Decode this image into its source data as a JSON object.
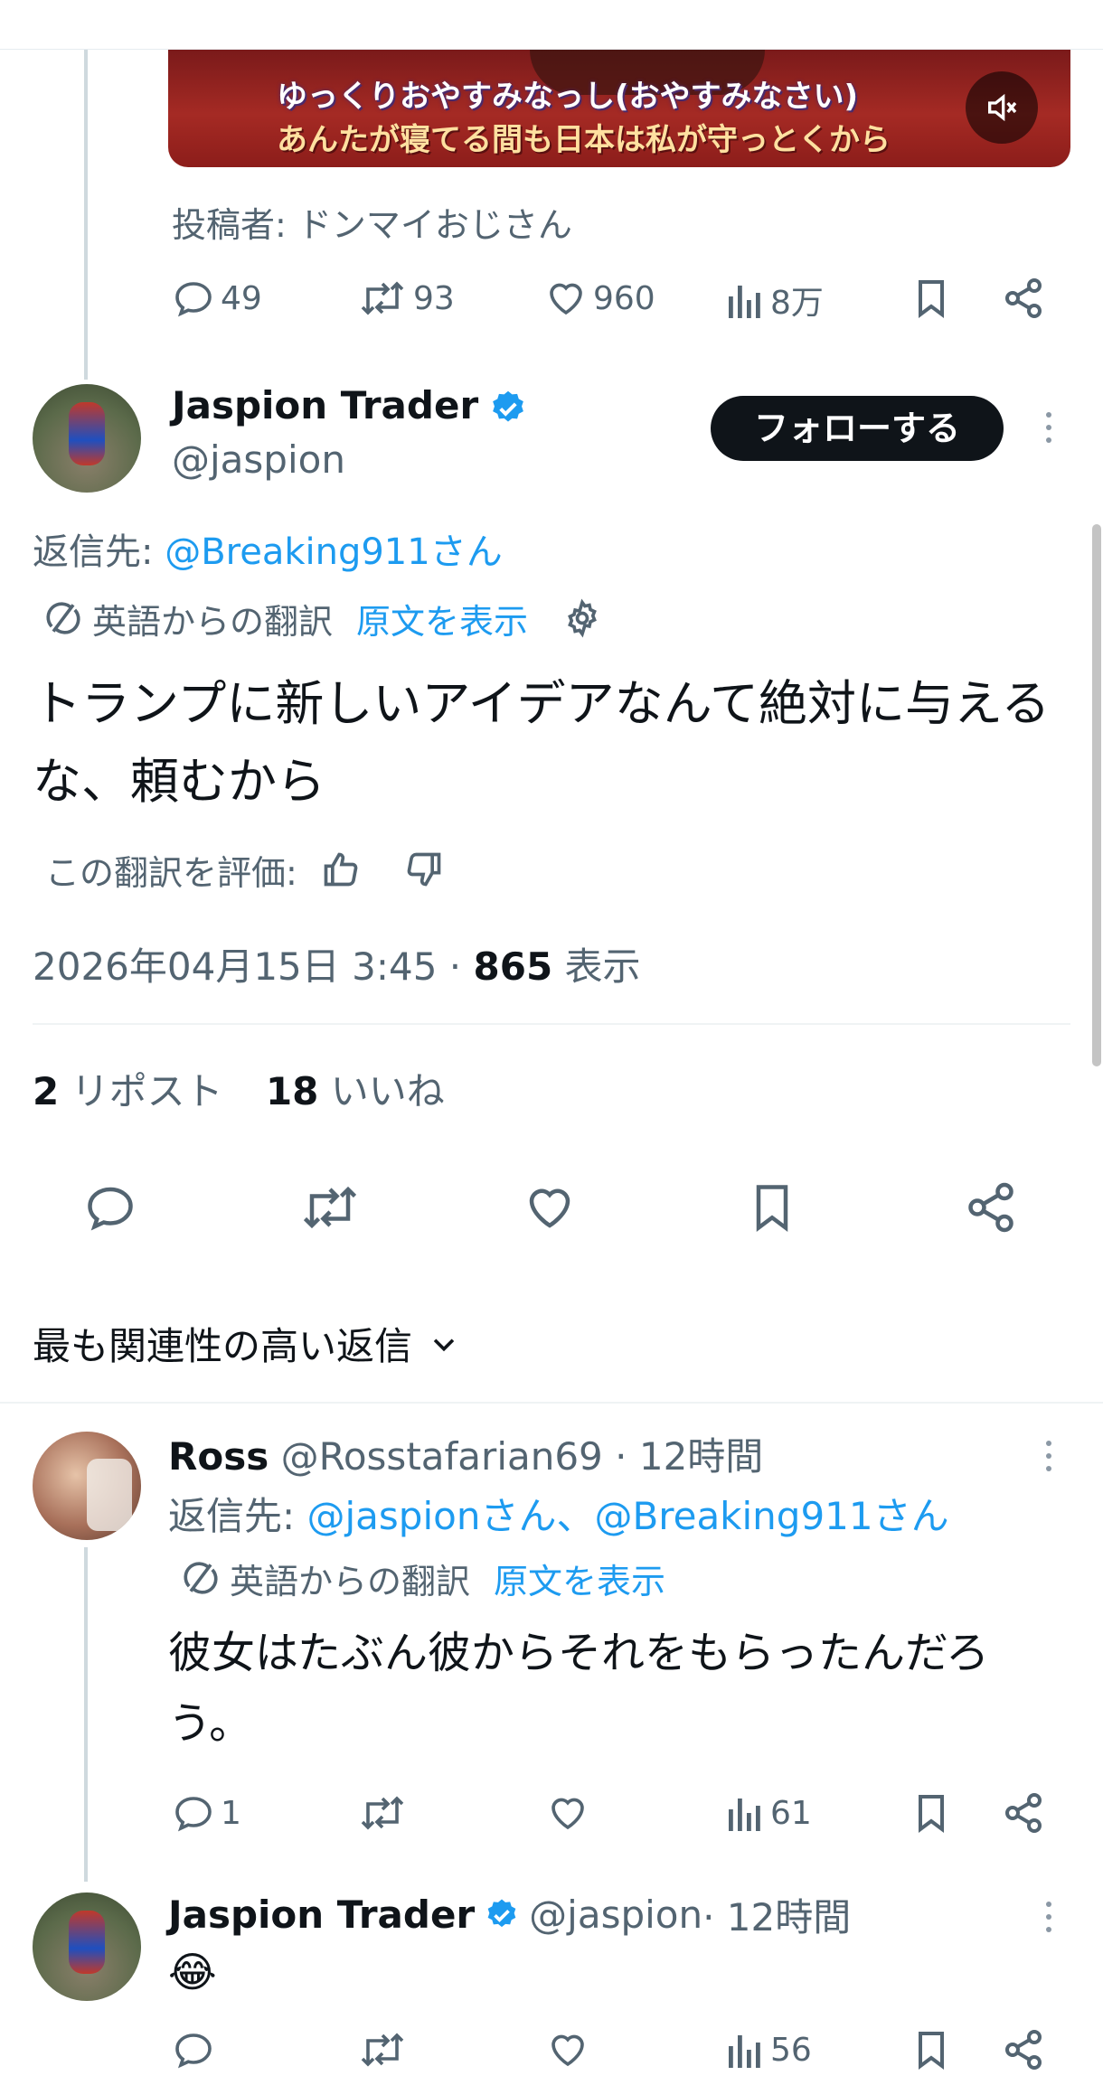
{
  "video": {
    "caption_line1": "ゆっくりおやすみなっし(おやすみなさい)",
    "caption_line2": "あんたが寝てる間も日本は私が守っとくから"
  },
  "quoted_post": {
    "posted_by": "投稿者: ドンマイおじさん",
    "stats": {
      "replies": "49",
      "reposts": "93",
      "likes": "960",
      "views": "8万"
    }
  },
  "main_post": {
    "author_name": "Jaspion Trader",
    "handle": "@jaspion",
    "follow_label": "フォローする",
    "reply_to_prefix": "返信先: ",
    "reply_to_handle": "@Breaking911さん",
    "translated_from": "英語からの翻訳",
    "show_original": "原文を表示",
    "text": "トランプに新しいアイデアなんて絶対に与えるな、頼むから",
    "rate_translation": "この翻訳を評価:",
    "timestamp": "2026年04月15日 3:45 · ",
    "views_count": "865",
    "views_label": " 表示",
    "reposts_count": "2",
    "reposts_label": " リポスト",
    "likes_count": "18",
    "likes_label": " いいね"
  },
  "replies_sort": {
    "label": "最も関連性の高い返信"
  },
  "replies": [
    {
      "name": "Ross",
      "handle": "@Rosstafarian69",
      "time": " · 12時間",
      "reply_to_prefix": "返信先: ",
      "reply_to_handles": "@jaspionさん、@Breaking911さん",
      "translated_from": "英語からの翻訳",
      "show_original": "原文を表示",
      "text": "彼女はたぶん彼からそれをもらったんだろう。",
      "stats": {
        "replies": "1",
        "views": "61"
      }
    },
    {
      "name": "Jaspion Trader",
      "handle": "@jaspion",
      "time": " · 12時間",
      "text": "😂",
      "stats": {
        "views": "56"
      }
    }
  ],
  "colors": {
    "accent": "#1d9bf0",
    "text": "#0f1419",
    "muted": "#536471",
    "divider": "#eff3f4",
    "verified": "#1d9bf0"
  }
}
